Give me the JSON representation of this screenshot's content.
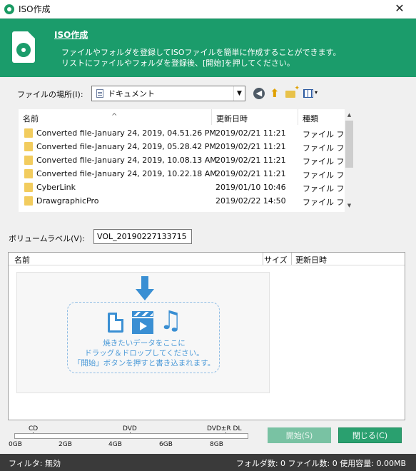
{
  "window": {
    "title": "ISO作成",
    "close_glyph": "✕"
  },
  "header": {
    "title": "ISO作成",
    "desc_line1": "ファイルやフォルダを登録してISOファイルを簡単に作成することができます。",
    "desc_line2": "リストにファイルやフォルダを登録後、[開始]を押してください。"
  },
  "location": {
    "label": "ファイルの場所(I):",
    "value": "ドキュメント",
    "dropdown_glyph": "▼"
  },
  "toolbar": {
    "back_glyph": "◀",
    "up_glyph": "⬆",
    "view_glyph": "▾"
  },
  "filelist": {
    "sort_glyph": "^",
    "columns": {
      "name": "名前",
      "date": "更新日時",
      "type": "種類"
    },
    "rows": [
      {
        "name": "Converted file-January 24, 2019, 04.51.26 PM",
        "date": "2019/02/21 11:21",
        "type": "ファイル フォルダー"
      },
      {
        "name": "Converted file-January 24, 2019, 05.28.42 PM",
        "date": "2019/02/21 11:21",
        "type": "ファイル フォルダー"
      },
      {
        "name": "Converted file-January 24, 2019, 10.08.13 AM",
        "date": "2019/02/21 11:21",
        "type": "ファイル フォルダー"
      },
      {
        "name": "Converted file-January 24, 2019, 10.22.18 AM",
        "date": "2019/02/21 11:21",
        "type": "ファイル フォルダー"
      },
      {
        "name": "CyberLink",
        "date": "2019/01/10 10:46",
        "type": "ファイル フォルダー"
      },
      {
        "name": "DrawgraphicPro",
        "date": "2019/02/22 14:50",
        "type": "ファイル フォルダー"
      }
    ],
    "scroll_up": "▲",
    "scroll_down": "▼"
  },
  "volume": {
    "label": "ボリュームラベル(V):",
    "value": "VOL_20190227133715"
  },
  "droplist": {
    "columns": {
      "name": "名前",
      "size": "サイズ",
      "date": "更新日時"
    },
    "hint_line1": "焼きたいデータをここに",
    "hint_line2": "ドラッグ＆ドロップしてください。",
    "hint_line3": "「開始」ボタンを押すと書き込まれます。",
    "music_glyph": "♫"
  },
  "capacity": {
    "media": [
      "CD",
      "DVD",
      "DVD±R DL"
    ],
    "scale": [
      "0GB",
      "2GB",
      "4GB",
      "6GB",
      "8GB"
    ]
  },
  "buttons": {
    "start": "開始(S)",
    "close": "閉じる(C)"
  },
  "status": {
    "filter": "フィルタ: 無効",
    "counts": "フォルダ数: 0  ファイル数: 0  使用容量: 0.00MB"
  }
}
